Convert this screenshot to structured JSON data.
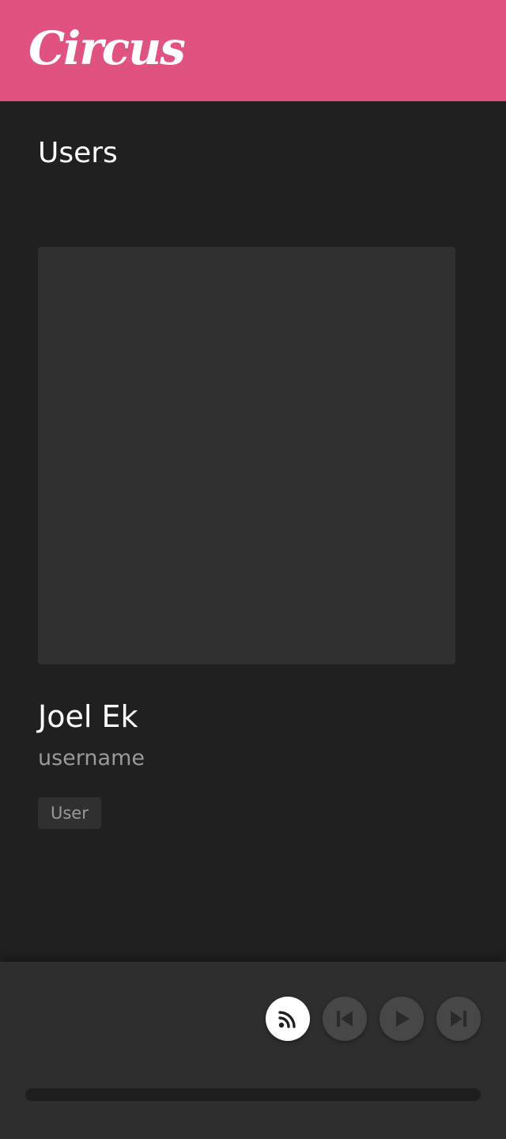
{
  "header": {
    "logo_text": "Circus",
    "brand_color": "#e05280"
  },
  "main": {
    "page_title": "Users",
    "user": {
      "name": "Joel Ek",
      "username": "username",
      "role": "User"
    }
  },
  "player": {
    "buttons": [
      {
        "icon": "rss-icon",
        "state": "active"
      },
      {
        "icon": "skip-previous-icon",
        "state": "inactive"
      },
      {
        "icon": "play-icon",
        "state": "inactive"
      },
      {
        "icon": "skip-next-icon",
        "state": "inactive"
      }
    ],
    "progress_fraction": 0
  }
}
